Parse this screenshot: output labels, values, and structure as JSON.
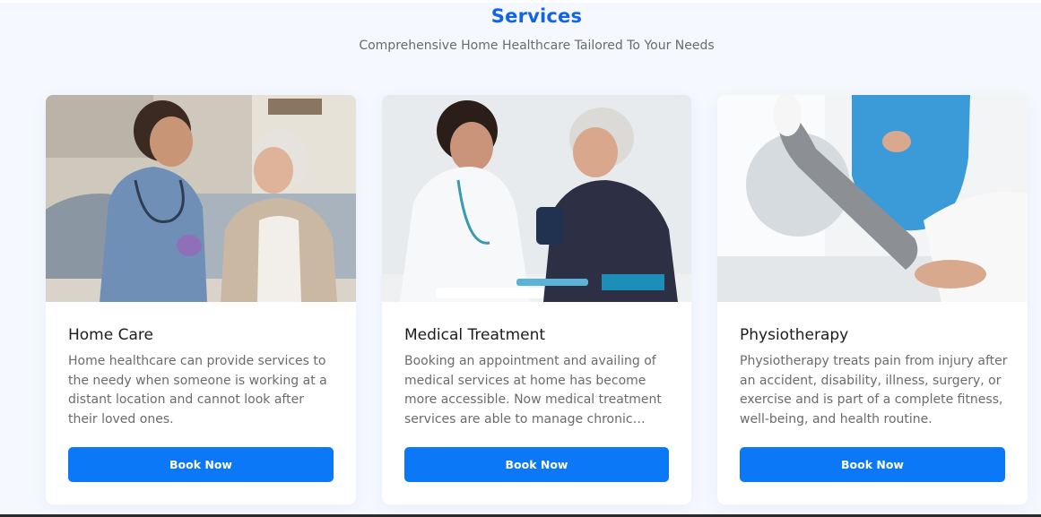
{
  "section": {
    "title": "Services",
    "subtitle": "Comprehensive Home Healthcare Tailored To Your Needs"
  },
  "cards": [
    {
      "title": "Home Care",
      "description": "Home healthcare can provide services to the needy when someone is working at a distant location and cannot look after their loved ones.",
      "button_label": "Book Now",
      "image_alt": "Nurse caring for elderly woman on sofa"
    },
    {
      "title": "Medical Treatment",
      "description": "Booking an appointment and availing of medical services at home has become more accessible. Now medical treatment services are able to manage chronic conditions at home.",
      "button_label": "Book Now",
      "image_alt": "Doctor measuring blood pressure of elderly woman"
    },
    {
      "title": "Physiotherapy",
      "description": "Physiotherapy treats pain from injury after an accident, disability, illness, surgery, or exercise and is part of a complete fitness, well-being, and health routine.",
      "button_label": "Book Now",
      "image_alt": "Physiotherapist stretching a patient's leg"
    }
  ],
  "colors": {
    "accent": "#1264e6",
    "button": "#0b78f7",
    "background": "#f5f8fe"
  }
}
